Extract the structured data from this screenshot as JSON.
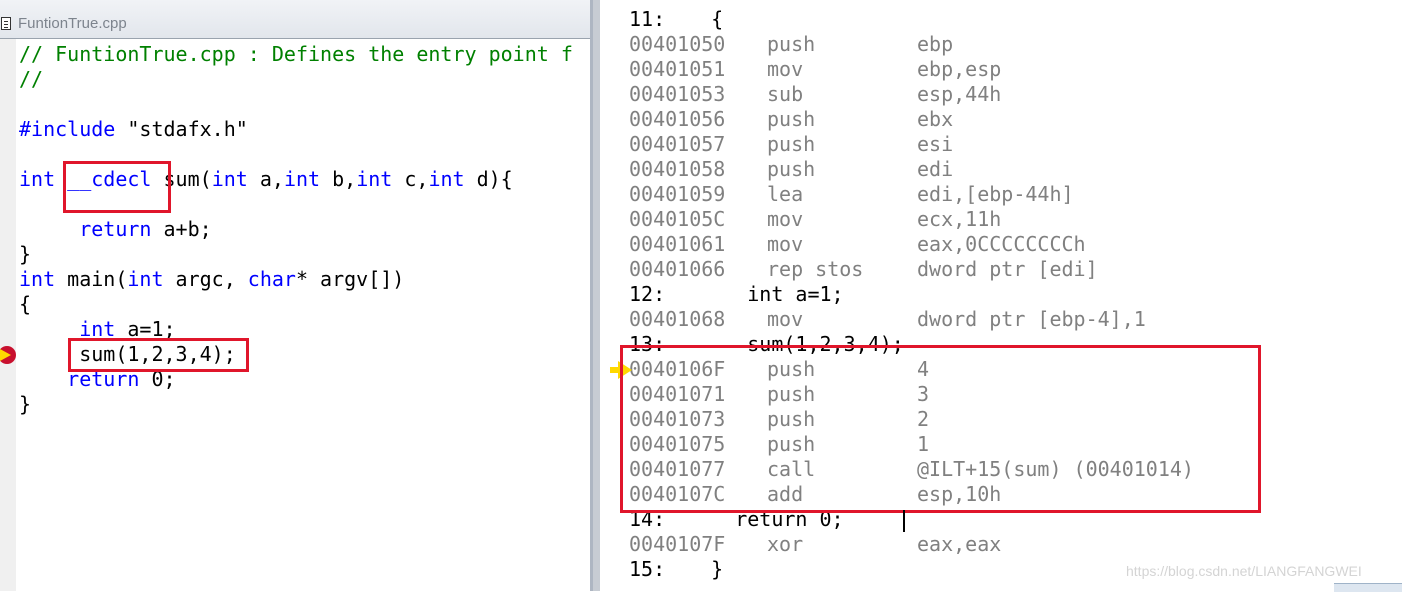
{
  "source_window": {
    "title": "FuntionTrue.cpp",
    "lines": [
      {
        "parts": [
          {
            "t": "// FuntionTrue.cpp : Defines the entry point f",
            "c": "cm"
          }
        ]
      },
      {
        "parts": [
          {
            "t": "//",
            "c": "cm"
          }
        ]
      },
      {
        "parts": []
      },
      {
        "parts": [
          {
            "t": "#include",
            "c": "pp"
          },
          {
            "t": " \"stdafx.h\"",
            "c": ""
          }
        ]
      },
      {
        "parts": []
      },
      {
        "parts": [
          {
            "t": "int",
            "c": "kw"
          },
          {
            "t": " ",
            "c": ""
          },
          {
            "t": "__cdecl",
            "c": "kw"
          },
          {
            "t": " sum(",
            "c": ""
          },
          {
            "t": "int",
            "c": "kw"
          },
          {
            "t": " a,",
            "c": ""
          },
          {
            "t": "int",
            "c": "kw"
          },
          {
            "t": " b,",
            "c": ""
          },
          {
            "t": "int",
            "c": "kw"
          },
          {
            "t": " c,",
            "c": ""
          },
          {
            "t": "int",
            "c": "kw"
          },
          {
            "t": " d){",
            "c": ""
          }
        ]
      },
      {
        "parts": []
      },
      {
        "parts": [
          {
            "t": "     ",
            "c": ""
          },
          {
            "t": "return",
            "c": "kw"
          },
          {
            "t": " a+b;",
            "c": ""
          }
        ]
      },
      {
        "parts": [
          {
            "t": "}",
            "c": ""
          }
        ]
      },
      {
        "parts": [
          {
            "t": "int",
            "c": "kw"
          },
          {
            "t": " main(",
            "c": ""
          },
          {
            "t": "int",
            "c": "kw"
          },
          {
            "t": " argc, ",
            "c": ""
          },
          {
            "t": "char",
            "c": "kw"
          },
          {
            "t": "* argv[])",
            "c": ""
          }
        ]
      },
      {
        "parts": [
          {
            "t": "{",
            "c": ""
          }
        ]
      },
      {
        "parts": [
          {
            "t": "     ",
            "c": ""
          },
          {
            "t": "int",
            "c": "kw"
          },
          {
            "t": " a=1;",
            "c": ""
          }
        ]
      },
      {
        "parts": [
          {
            "t": "     sum(1,2,3,4);",
            "c": ""
          }
        ]
      },
      {
        "parts": [
          {
            "t": "    ",
            "c": ""
          },
          {
            "t": "return",
            "c": "kw"
          },
          {
            "t": " 0;",
            "c": ""
          }
        ]
      },
      {
        "parts": [
          {
            "t": "}",
            "c": ""
          }
        ]
      }
    ]
  },
  "disassembly": {
    "rows": [
      {
        "kind": "src",
        "num": "11:",
        "code": "   {"
      },
      {
        "kind": "asm",
        "addr": "00401050",
        "mn": "push",
        "op": "ebp"
      },
      {
        "kind": "asm",
        "addr": "00401051",
        "mn": "mov",
        "op": "ebp,esp"
      },
      {
        "kind": "asm",
        "addr": "00401053",
        "mn": "sub",
        "op": "esp,44h"
      },
      {
        "kind": "asm",
        "addr": "00401056",
        "mn": "push",
        "op": "ebx"
      },
      {
        "kind": "asm",
        "addr": "00401057",
        "mn": "push",
        "op": "esi"
      },
      {
        "kind": "asm",
        "addr": "00401058",
        "mn": "push",
        "op": "edi"
      },
      {
        "kind": "asm",
        "addr": "00401059",
        "mn": "lea",
        "op": "edi,[ebp-44h]"
      },
      {
        "kind": "asm",
        "addr": "0040105C",
        "mn": "mov",
        "op": "ecx,11h"
      },
      {
        "kind": "asm",
        "addr": "00401061",
        "mn": "mov",
        "op": "eax,0CCCCCCCCh"
      },
      {
        "kind": "asm",
        "addr": "00401066",
        "mn": "rep stos",
        "op": "dword ptr [edi]"
      },
      {
        "kind": "src",
        "num": "12:",
        "code": "      int a=1;"
      },
      {
        "kind": "asm",
        "addr": "00401068",
        "mn": "mov",
        "op": "dword ptr [ebp-4],1"
      },
      {
        "kind": "src",
        "num": "13:",
        "code": "      sum(1,2,3,4);"
      },
      {
        "kind": "asm",
        "addr": "0040106F",
        "mn": "push",
        "op": "4"
      },
      {
        "kind": "asm",
        "addr": "00401071",
        "mn": "push",
        "op": "3"
      },
      {
        "kind": "asm",
        "addr": "00401073",
        "mn": "push",
        "op": "2"
      },
      {
        "kind": "asm",
        "addr": "00401075",
        "mn": "push",
        "op": "1"
      },
      {
        "kind": "asm",
        "addr": "00401077",
        "mn": "call",
        "op": "@ILT+15(sum) (00401014)"
      },
      {
        "kind": "asm",
        "addr": "0040107C",
        "mn": "add",
        "op": "esp,10h"
      },
      {
        "kind": "src",
        "num": "14:",
        "code": "     return 0;"
      },
      {
        "kind": "asm",
        "addr": "0040107F",
        "mn": "xor",
        "op": "eax,eax"
      },
      {
        "kind": "src",
        "num": "15:",
        "code": "   }"
      }
    ]
  },
  "watermark": "https://blog.csdn.net/LIANGFANGWEI",
  "colors": {
    "highlight_box": "#e0162b",
    "keyword": "#0000ff",
    "comment": "#008000",
    "asm_text": "#808080",
    "exec_arrow": "#ffd800"
  },
  "icons": {
    "document": "document-icon",
    "breakpoint_arrow": "current-line-arrow-icon",
    "exec_arrow": "execution-pointer-icon"
  }
}
